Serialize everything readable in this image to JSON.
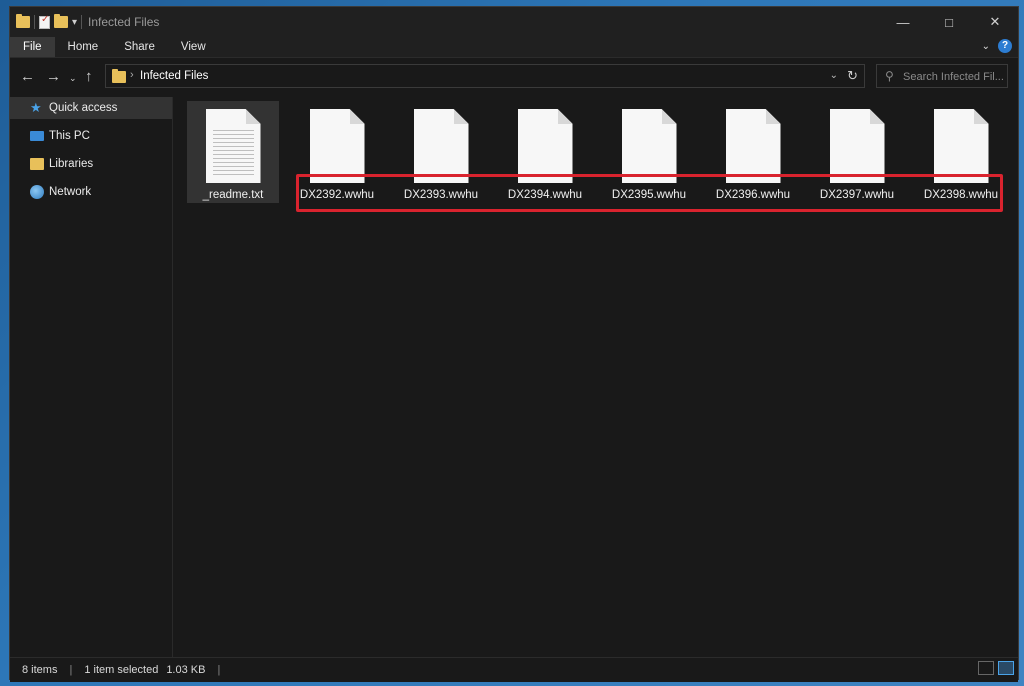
{
  "window": {
    "title": "Infected Files"
  },
  "ribbon": {
    "tabs": [
      "File",
      "Home",
      "Share",
      "View"
    ]
  },
  "nav": {
    "path": "Infected Files"
  },
  "search": {
    "placeholder": "Search Infected Fil..."
  },
  "sidebar": {
    "items": [
      {
        "label": "Quick access",
        "icon": "star-icon"
      },
      {
        "label": "This PC",
        "icon": "computer-icon"
      },
      {
        "label": "Libraries",
        "icon": "libraries-icon"
      },
      {
        "label": "Network",
        "icon": "network-icon"
      }
    ]
  },
  "files": [
    {
      "name": "_readme.txt"
    },
    {
      "name": "DX2392.wwhu"
    },
    {
      "name": "DX2393.wwhu"
    },
    {
      "name": "DX2394.wwhu"
    },
    {
      "name": "DX2395.wwhu"
    },
    {
      "name": "DX2396.wwhu"
    },
    {
      "name": "DX2397.wwhu"
    },
    {
      "name": "DX2398.wwhu"
    }
  ],
  "status": {
    "items": "8 items",
    "selected": "1 item selected",
    "size": "1.03 KB"
  },
  "colors": {
    "highlight": "#d9232e",
    "accent": "#2d7dd2",
    "folder": "#e8c05a"
  }
}
